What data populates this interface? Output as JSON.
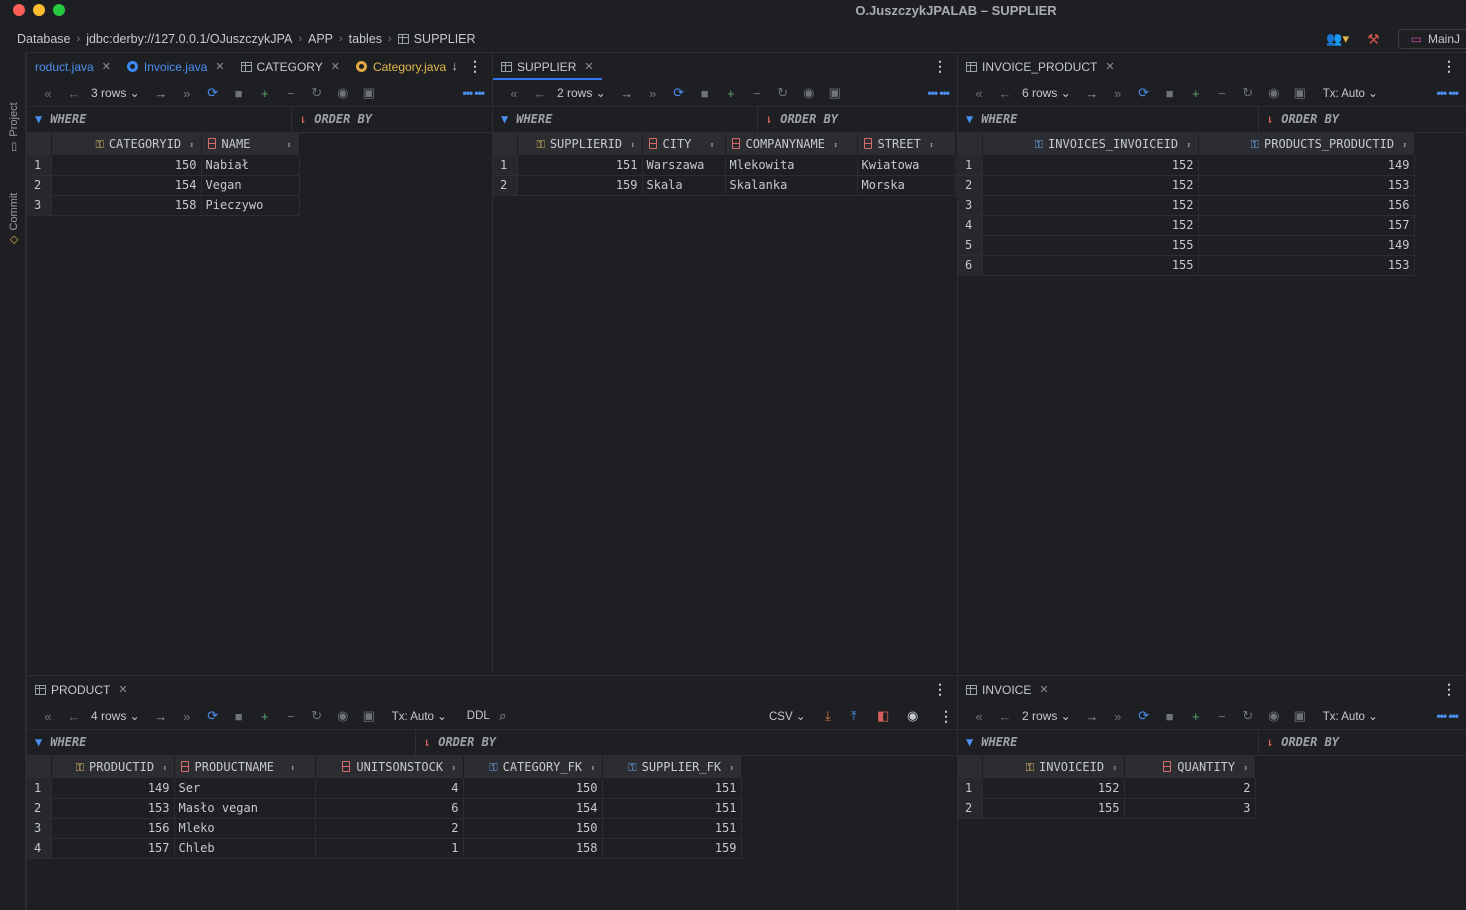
{
  "window": {
    "title": "O.JuszczykJPALAB – SUPPLIER"
  },
  "breadcrumb": [
    "Database",
    "jdbc:derby://127.0.0.1/OJuszczykJPA",
    "APP",
    "tables",
    "SUPPLIER"
  ],
  "right_tools": {
    "main_tab": "MainJ"
  },
  "sidebar": {
    "project": "Project",
    "commit": "Commit"
  },
  "filter": {
    "where": "WHERE",
    "order_by": "ORDER BY"
  },
  "toolbar": {
    "tx": "Tx: Auto",
    "ddl": "DDL",
    "csv": "CSV"
  },
  "panels": {
    "left": {
      "tabs": [
        "roduct.java",
        "Invoice.java",
        "CATEGORY",
        "Category.java"
      ],
      "rows": "3 rows",
      "columns": [
        "CATEGORYID",
        "NAME"
      ],
      "data": [
        [
          "1",
          "150",
          "Nabiał"
        ],
        [
          "2",
          "154",
          "Vegan"
        ],
        [
          "3",
          "158",
          "Pieczywo"
        ]
      ]
    },
    "supplier": {
      "tab": "SUPPLIER",
      "rows": "2 rows",
      "columns": [
        "SUPPLIERID",
        "CITY",
        "COMPANYNAME",
        "STREET"
      ],
      "data": [
        [
          "1",
          "151",
          "Warszawa",
          "Mlekowita",
          "Kwiatowa"
        ],
        [
          "2",
          "159",
          "Skala",
          "Skalanka",
          "Morska"
        ]
      ]
    },
    "invoice_product": {
      "tab": "INVOICE_PRODUCT",
      "rows": "6 rows",
      "columns": [
        "INVOICES_INVOICEID",
        "PRODUCTS_PRODUCTID"
      ],
      "data": [
        [
          "1",
          "152",
          "149"
        ],
        [
          "2",
          "152",
          "153"
        ],
        [
          "3",
          "152",
          "156"
        ],
        [
          "4",
          "152",
          "157"
        ],
        [
          "5",
          "155",
          "149"
        ],
        [
          "6",
          "155",
          "153"
        ]
      ]
    },
    "product": {
      "tab": "PRODUCT",
      "rows": "4 rows",
      "columns": [
        "PRODUCTID",
        "PRODUCTNAME",
        "UNITSONSTOCK",
        "CATEGORY_FK",
        "SUPPLIER_FK"
      ],
      "data": [
        [
          "1",
          "149",
          "Ser",
          "4",
          "150",
          "151"
        ],
        [
          "2",
          "153",
          "Masło vegan",
          "6",
          "154",
          "151"
        ],
        [
          "3",
          "156",
          "Mleko",
          "2",
          "150",
          "151"
        ],
        [
          "4",
          "157",
          "Chleb",
          "1",
          "158",
          "159"
        ]
      ]
    },
    "invoice": {
      "tab": "INVOICE",
      "rows": "2 rows",
      "columns": [
        "INVOICEID",
        "QUANTITY"
      ],
      "data": [
        [
          "1",
          "152",
          "2"
        ],
        [
          "2",
          "155",
          "3"
        ]
      ]
    }
  }
}
